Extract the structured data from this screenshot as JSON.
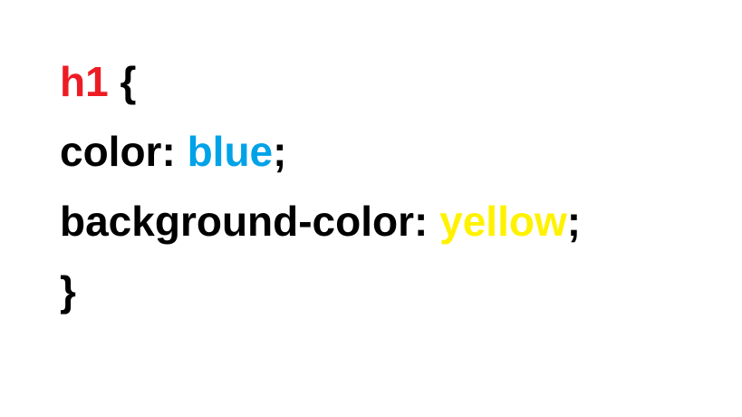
{
  "colors": {
    "selector": "#ed1c24",
    "value_blue": "#00a2e8",
    "value_yellow": "#fff200",
    "text": "#000000",
    "background": "#ffffff"
  },
  "code": {
    "line1": {
      "selector": "h1",
      "open_brace": " {"
    },
    "line2": {
      "property": "color: ",
      "value": "blue",
      "terminator": ";"
    },
    "line3": {
      "property": "background-color: ",
      "value": "yellow",
      "terminator": ";"
    },
    "line4": {
      "close_brace": "}"
    }
  }
}
